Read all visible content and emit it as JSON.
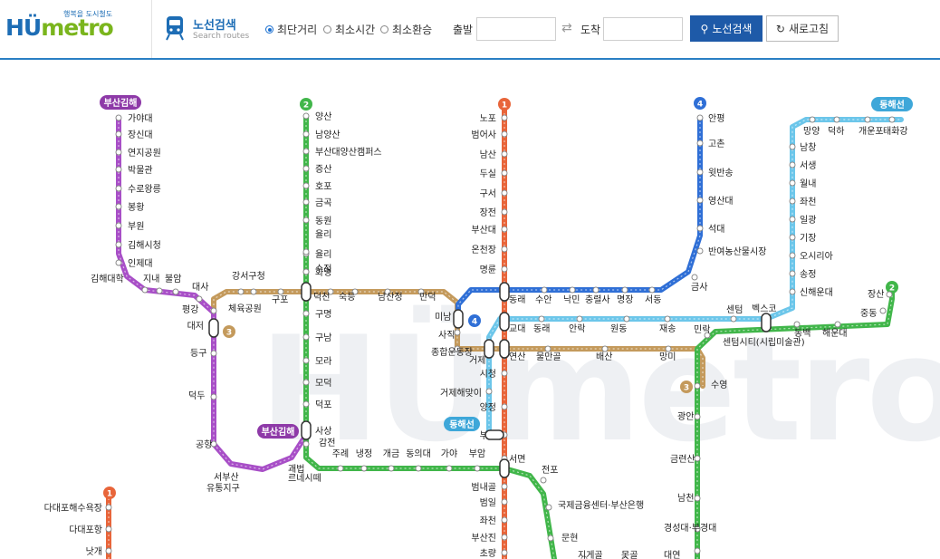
{
  "header": {
    "logo_text_main": "HÜ",
    "logo_text_accent": "metro",
    "logo_tagline": "행복을 도시철도",
    "route_title": "노선검색",
    "route_subtitle": "Search routes",
    "options": [
      "최단거리",
      "최소시간",
      "최소환승"
    ],
    "selected_option": "최단거리",
    "departure_label": "출발",
    "arrival_label": "도착",
    "departure_value": "",
    "arrival_value": "",
    "search_button": "노선검색",
    "refresh_button": "새로고침"
  },
  "watermark": "HÜmetro",
  "colors": {
    "line1": "#e8653a",
    "line2": "#41b64a",
    "line3": "#c49a5c",
    "line4": "#2f6fd6",
    "donghae": "#6cc6ea",
    "gimhae": "#a84fc7",
    "accent": "#1e5aa8"
  },
  "badges": {
    "line1": "1",
    "line2": "2",
    "line3": "3",
    "line4": "4",
    "donghae": "동해선",
    "gimhae": "부산김해"
  },
  "stations": {
    "line1": [
      "노포",
      "범어사",
      "남산",
      "두실",
      "구서",
      "장전",
      "부산대",
      "온천장",
      "명륜",
      "동래",
      "교대",
      "연산",
      "시청",
      "양정",
      "부전",
      "서면",
      "범내골",
      "범일",
      "좌천",
      "부산진",
      "초량"
    ],
    "line1_south": [
      "다대포해수욕장",
      "다대포항",
      "낫개"
    ],
    "line2": [
      "양산",
      "남양산",
      "부산대양산캠퍼스",
      "증산",
      "호포",
      "금곡",
      "동원",
      "율리",
      "화명",
      "수정",
      "덕천",
      "구명",
      "구남",
      "모라",
      "모덕",
      "덕포",
      "사상",
      "감전",
      "주례",
      "냉정",
      "개금",
      "동의대",
      "가야",
      "부암",
      "서면",
      "전포",
      "국제금융센터·부산은행",
      "문현",
      "지게골",
      "못골",
      "대연",
      "경성대·부경대",
      "남천",
      "금련산",
      "광안",
      "수영",
      "민락",
      "센텀시티(시립미술관)",
      "벡스코",
      "동백",
      "해운대",
      "중동",
      "장산"
    ],
    "line3": [
      "대저",
      "체육공원",
      "강서구청",
      "구포",
      "덕천",
      "숙등",
      "남산정",
      "만덕",
      "미남",
      "사직",
      "종합운동장",
      "거제",
      "연산",
      "물만골",
      "배산",
      "망미",
      "수영"
    ],
    "line4": [
      "안평",
      "고촌",
      "윗반송",
      "영산대",
      "석대",
      "반여농산물시장",
      "금사",
      "서동",
      "명장",
      "충렬사",
      "낙민",
      "수안",
      "동래",
      "미남"
    ],
    "donghae": [
      "태화강",
      "개운포",
      "덕하",
      "망양",
      "남창",
      "서생",
      "월내",
      "좌천",
      "일광",
      "기장",
      "오시리아",
      "송정",
      "신해운대",
      "벡스코",
      "센텀",
      "재송",
      "원동",
      "안락",
      "동래",
      "교대",
      "거제",
      "거제해맞이",
      "부전"
    ],
    "gimhae": [
      "가야대",
      "장신대",
      "연지공원",
      "박물관",
      "수로왕릉",
      "봉황",
      "부원",
      "김해시청",
      "인제대",
      "김해대학",
      "지내",
      "불암",
      "대사",
      "평강",
      "대저",
      "등구",
      "덕두",
      "공항",
      "서부산유통지구",
      "괘법르네시떼",
      "사상"
    ]
  }
}
